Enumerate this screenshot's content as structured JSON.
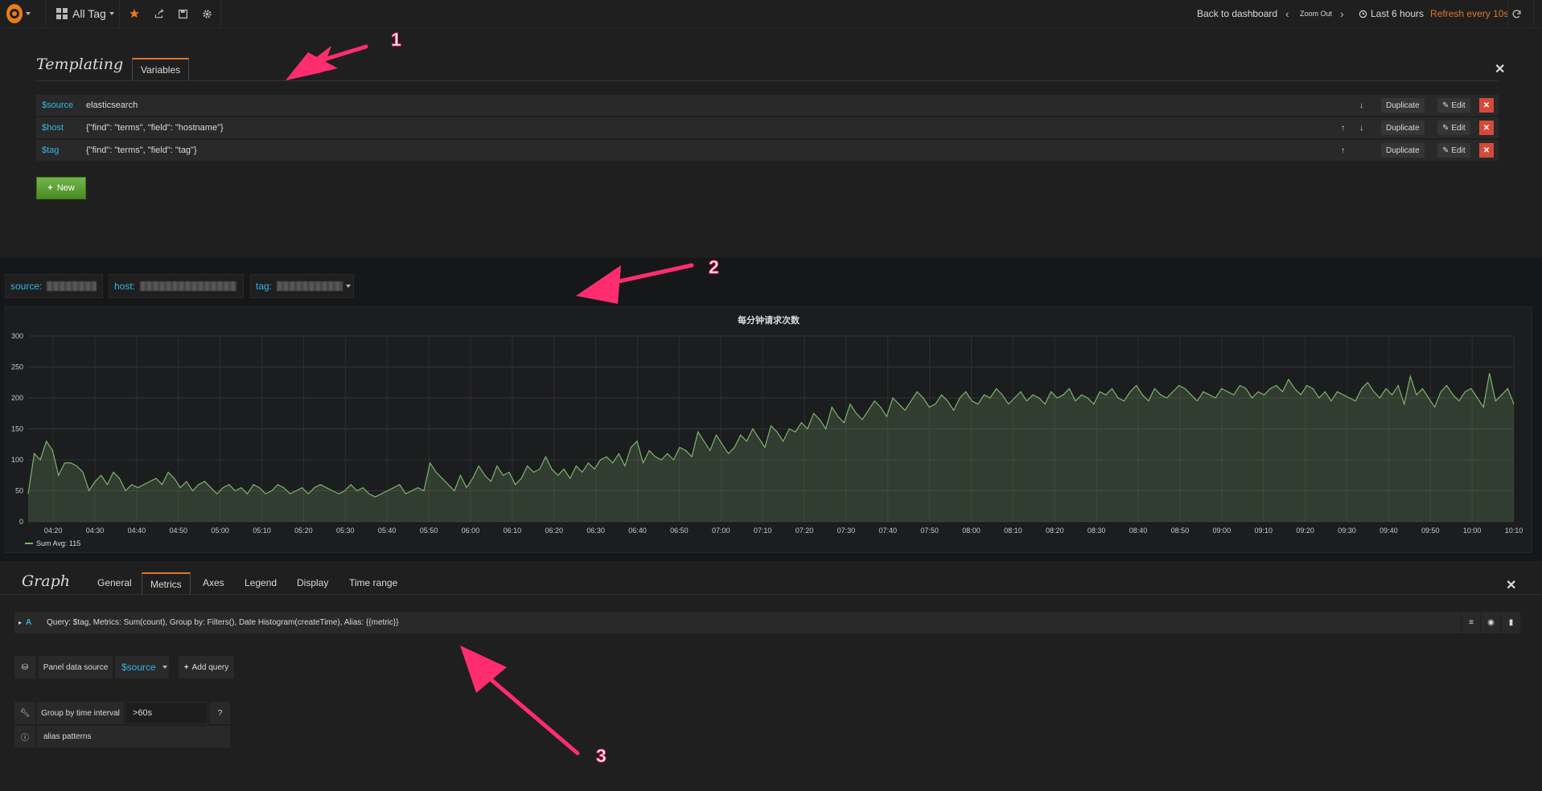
{
  "topbar": {
    "dashboard_title": "All Tag",
    "back_label": "Back to dashboard",
    "zoom_out_label": "Zoom Out",
    "time_range_label": "Last 6 hours",
    "refresh_label": "Refresh every 10s"
  },
  "templating": {
    "title": "Templating",
    "tab_label": "Variables",
    "variables": [
      {
        "name": "$source",
        "query": "elasticsearch"
      },
      {
        "name": "$host",
        "query": "{\"find\": \"terms\", \"field\": \"hostname\"}"
      },
      {
        "name": "$tag",
        "query": "{\"find\": \"terms\", \"field\": \"tag\"}"
      }
    ],
    "duplicate_label": "Duplicate",
    "edit_label": "Edit",
    "new_label": "New"
  },
  "variable_selectors": [
    {
      "label": "source:"
    },
    {
      "label": "host:"
    },
    {
      "label": "tag:"
    }
  ],
  "panel": {
    "title": "每分钟请求次数",
    "legend": "Sum  Avg: 115"
  },
  "chart_data": {
    "type": "area",
    "title": "每分钟请求次数",
    "ylim": [
      0,
      300
    ],
    "yticks": [
      "0",
      "50",
      "100",
      "150",
      "200",
      "250",
      "300"
    ],
    "xticks": [
      "04:20",
      "04:30",
      "04:40",
      "04:50",
      "05:00",
      "05:10",
      "05:20",
      "05:30",
      "05:40",
      "05:50",
      "06:00",
      "06:10",
      "06:20",
      "06:30",
      "06:40",
      "06:50",
      "07:00",
      "07:10",
      "07:20",
      "07:30",
      "07:40",
      "07:50",
      "08:00",
      "08:10",
      "08:20",
      "08:30",
      "08:40",
      "08:50",
      "09:00",
      "09:10",
      "09:20",
      "09:30",
      "09:40",
      "09:50",
      "10:00",
      "10:10"
    ],
    "x_start": "04:14",
    "x_end": "10:10",
    "series": [
      {
        "name": "Sum",
        "color": "#7eb26d",
        "values": [
          45,
          110,
          100,
          130,
          115,
          75,
          95,
          95,
          90,
          80,
          50,
          65,
          75,
          60,
          80,
          70,
          50,
          60,
          55,
          60,
          65,
          70,
          60,
          80,
          70,
          55,
          65,
          50,
          60,
          65,
          55,
          45,
          55,
          60,
          50,
          55,
          45,
          60,
          55,
          45,
          50,
          60,
          55,
          45,
          50,
          55,
          45,
          55,
          60,
          55,
          50,
          45,
          50,
          60,
          50,
          55,
          45,
          40,
          45,
          50,
          55,
          60,
          45,
          50,
          55,
          50,
          95,
          80,
          70,
          60,
          50,
          75,
          55,
          70,
          90,
          75,
          65,
          90,
          75,
          80,
          60,
          70,
          90,
          80,
          85,
          105,
          85,
          75,
          85,
          70,
          90,
          80,
          95,
          85,
          100,
          105,
          95,
          110,
          90,
          120,
          130,
          95,
          115,
          105,
          100,
          110,
          100,
          120,
          115,
          105,
          145,
          130,
          115,
          140,
          125,
          110,
          120,
          140,
          130,
          150,
          135,
          120,
          155,
          145,
          130,
          150,
          145,
          160,
          150,
          175,
          165,
          150,
          185,
          170,
          160,
          190,
          175,
          165,
          180,
          195,
          185,
          170,
          200,
          190,
          180,
          195,
          210,
          200,
          185,
          190,
          205,
          195,
          180,
          200,
          210,
          195,
          190,
          205,
          200,
          215,
          205,
          190,
          200,
          210,
          195,
          205,
          200,
          190,
          210,
          200,
          205,
          215,
          195,
          205,
          200,
          190,
          210,
          205,
          215,
          200,
          195,
          210,
          220,
          205,
          195,
          215,
          205,
          200,
          210,
          220,
          215,
          205,
          195,
          210,
          205,
          200,
          215,
          210,
          205,
          220,
          215,
          200,
          210,
          205,
          215,
          220,
          210,
          230,
          215,
          205,
          220,
          215,
          200,
          210,
          195,
          210,
          205,
          200,
          195,
          215,
          225,
          210,
          200,
          215,
          205,
          220,
          190,
          235,
          205,
          215,
          200,
          185,
          210,
          220,
          205,
          195,
          210,
          215,
          200,
          185,
          240,
          195,
          205,
          215,
          190
        ]
      }
    ]
  },
  "graph_editor": {
    "title": "Graph",
    "tabs": [
      "General",
      "Metrics",
      "Axes",
      "Legend",
      "Display",
      "Time range"
    ],
    "active_tab": "Metrics",
    "query_letter": "A",
    "query_text": "Query: $tag, Metrics: Sum(count), Group by: Filters(), Date Histogram(createTime), Alias: {{metric}}",
    "panel_data_source_label": "Panel data source",
    "data_source_value": "$source",
    "add_query_label": "Add query",
    "group_by_label": "Group by time interval",
    "group_by_value": ">60s",
    "alias_label": "alias patterns"
  },
  "annotations": [
    "1",
    "2",
    "3"
  ],
  "colors": {
    "accent": "#e0752d",
    "link": "#33b5e5",
    "arrow": "#ff2d6f",
    "series": "#7eb26d"
  }
}
